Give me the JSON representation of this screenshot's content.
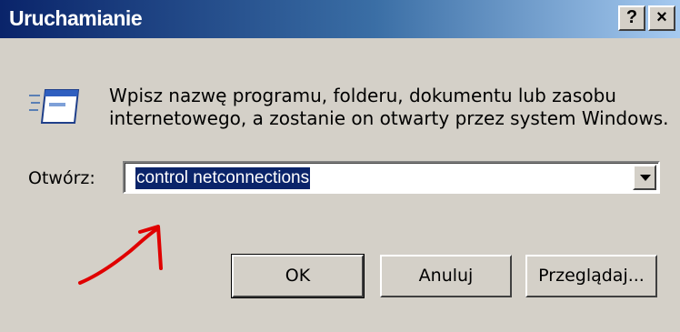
{
  "window": {
    "title": "Uruchamianie",
    "help_button": "?",
    "close_button": "×"
  },
  "description": {
    "line1": "Wpisz nazwę programu, folderu, dokumentu lub zasobu",
    "line2": "internetowego, a zostanie on otwarty przez system Windows."
  },
  "open_field": {
    "label": "Otwórz:",
    "value": "control netconnections"
  },
  "buttons": {
    "ok": "OK",
    "cancel": "Anuluj",
    "browse": "Przeglądaj..."
  },
  "icons": {
    "run": "run-program-icon",
    "annotation": "hand-drawn-red-arrow-icon"
  },
  "colors": {
    "title_bar_start": "#0a246a",
    "title_bar_end": "#a6caf0",
    "dialog_face": "#d4d0c8",
    "selection": "#0a246a",
    "annotation": "#e00000"
  }
}
